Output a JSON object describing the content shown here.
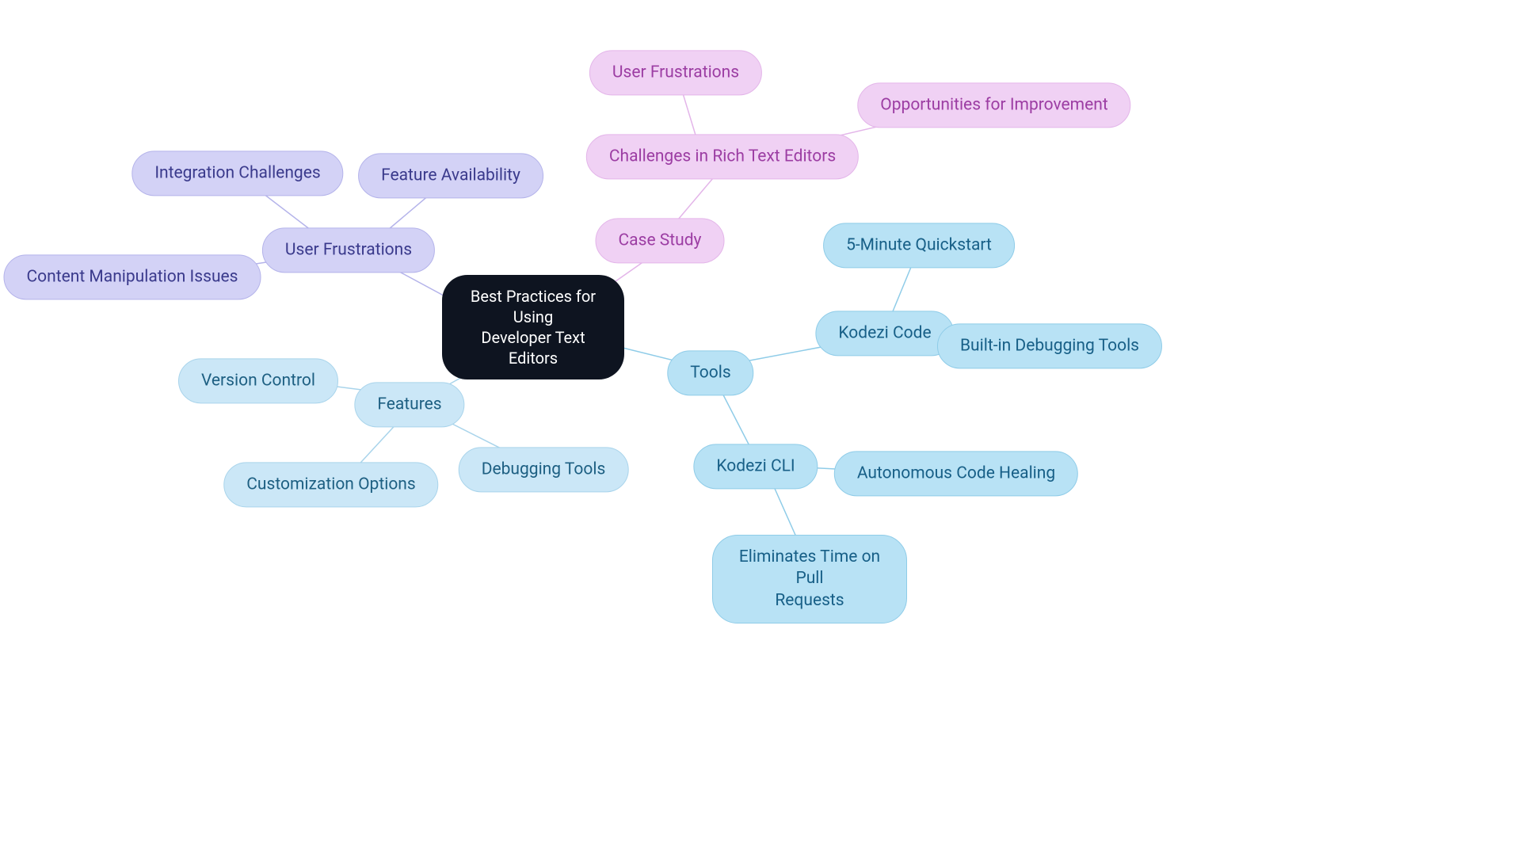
{
  "root": {
    "title": "Best Practices for Using\nDeveloper Text Editors"
  },
  "tools": {
    "label": "Tools",
    "kodezi_code": {
      "label": "Kodezi Code",
      "quickstart": "5-Minute Quickstart",
      "debug": "Built-in Debugging Tools"
    },
    "kodezi_cli": {
      "label": "Kodezi CLI",
      "healing": "Autonomous Code Healing",
      "pulls": "Eliminates Time on Pull\nRequests"
    }
  },
  "features": {
    "label": "Features",
    "version": "Version Control",
    "custom": "Customization Options",
    "debug": "Debugging Tools"
  },
  "frustrations": {
    "label": "User Frustrations",
    "integration": "Integration Challenges",
    "feature": "Feature Availability",
    "content": "Content Manipulation Issues"
  },
  "case_study": {
    "label": "Case Study",
    "challenges": {
      "label": "Challenges in Rich Text Editors",
      "frustrations": "User Frustrations",
      "opportunities": "Opportunities for Improvement"
    }
  }
}
